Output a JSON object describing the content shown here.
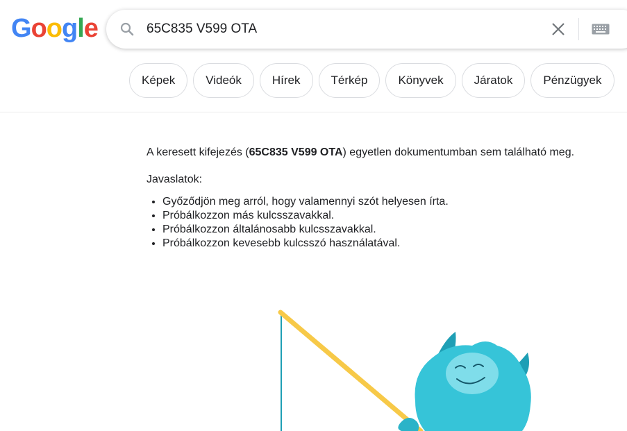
{
  "logo": {
    "letters": [
      "G",
      "o",
      "o",
      "g",
      "l",
      "e"
    ],
    "colors": [
      "#4285F4",
      "#EA4335",
      "#FBBC05",
      "#4285F4",
      "#34A853",
      "#EA4335"
    ]
  },
  "search": {
    "query": "65C835 V599 OTA",
    "icons": {
      "search": "search-icon",
      "clear": "close-icon",
      "keyboard": "keyboard-icon"
    }
  },
  "tabs": [
    {
      "label": "Képek"
    },
    {
      "label": "Videók"
    },
    {
      "label": "Hírek"
    },
    {
      "label": "Térkép"
    },
    {
      "label": "Könyvek"
    },
    {
      "label": "Járatok"
    },
    {
      "label": "Pénzügyek"
    }
  ],
  "results": {
    "message_before": "A keresett kifejezés (",
    "message_query": "65C835 V599 OTA",
    "message_after": ") egyetlen dokumentumban sem található meg.",
    "suggestions_title": "Javaslatok:",
    "suggestions": [
      "Győződjön meg arról, hogy valamennyi szót helyesen írta.",
      "Próbálkozzon más kulcsszavakkal.",
      "Próbálkozzon általánosabb kulcsszavakkal.",
      "Próbálkozzon kevesebb kulcsszó használatával."
    ]
  },
  "illustration": {
    "name": "fishing-monster",
    "body_color": "#36C4D8",
    "rod_color": "#F7C948",
    "line_color": "#1E9FB5"
  }
}
